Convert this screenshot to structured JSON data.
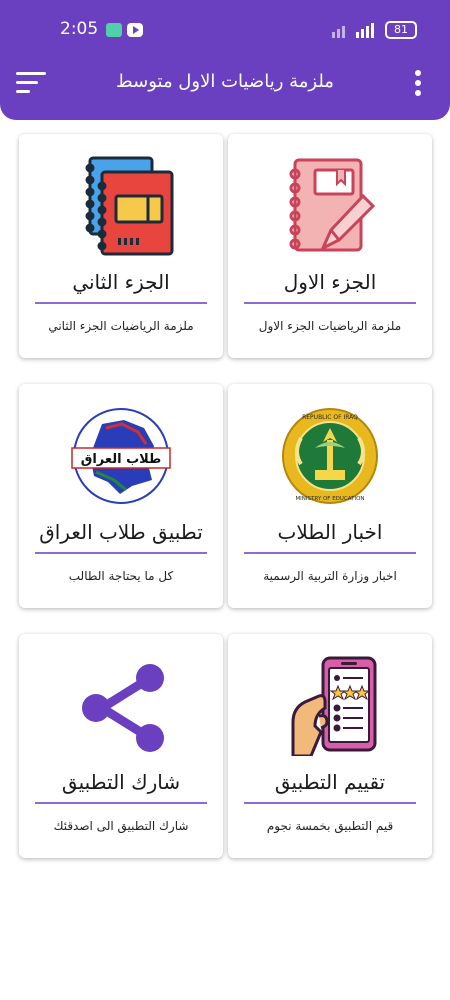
{
  "colors": {
    "primary": "#6a3fc0",
    "divider": "#8e6ad3"
  },
  "status_bar": {
    "time": "2:05",
    "battery": "81",
    "icons": [
      "app-notification-icon",
      "youtube-icon",
      "signal-icon",
      "battery-icon"
    ]
  },
  "app_bar": {
    "title": "ملزمة رياضيات الاول متوسط",
    "menu_icon": "hamburger-icon",
    "more_icon": "more-vertical-icon"
  },
  "cards": [
    {
      "title": "الجزء الاول",
      "subtitle": "ملزمة الرياضيات الجزء الاول",
      "icon": "notebook-pencil-icon"
    },
    {
      "title": "الجزء الثاني",
      "subtitle": "ملزمة الرياضيات الجزء الثاني",
      "icon": "notebooks-icon"
    },
    {
      "title": "اخبار الطلاب",
      "subtitle": "اخبار وزارة التربية الرسمية",
      "icon": "ministry-emblem-icon",
      "emblem_text_top": "REPUBLIC OF IRAQ",
      "emblem_text_bottom": "MINISTRY OF EDUCATION"
    },
    {
      "title": "تطبيق طلاب العراق",
      "subtitle": "كل ما يحتاجة الطالب",
      "icon": "iraq-map-icon",
      "badge_text": "طلاب العراق"
    },
    {
      "title": "تقييم التطبيق",
      "subtitle": "قيم التطبيق بخمسة نجوم",
      "icon": "phone-rating-icon"
    },
    {
      "title": "شارك التطبيق",
      "subtitle": "شارك التطبيق الى اصدقئك",
      "icon": "share-icon"
    }
  ]
}
